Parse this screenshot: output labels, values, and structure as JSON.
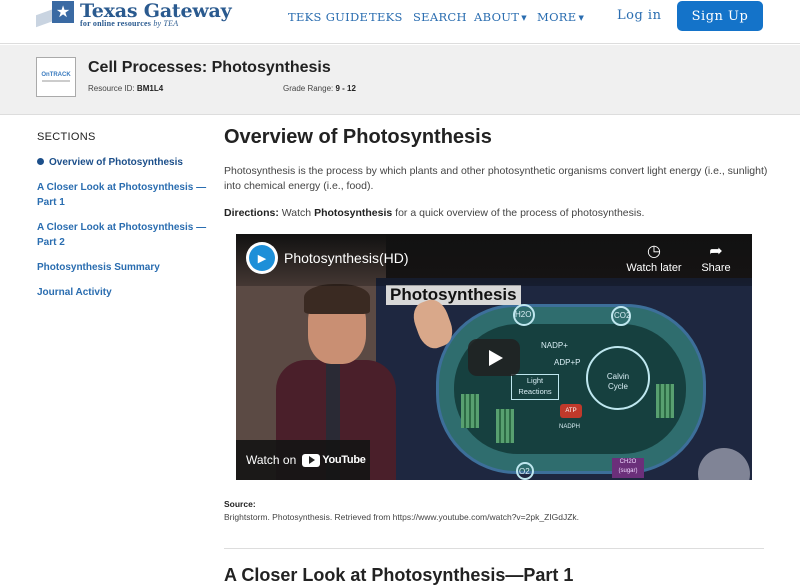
{
  "brand": {
    "title": "Texas Gateway",
    "subtitle_main": "for online resources",
    "subtitle_by": "by TEA"
  },
  "nav": {
    "items": [
      {
        "label": "TEKS GUIDE"
      },
      {
        "label": "TEKS"
      },
      {
        "label": "SEARCH"
      },
      {
        "label": "ABOUT"
      },
      {
        "label": "MORE"
      }
    ],
    "login_label": "Log in",
    "signup_label": "Sign Up"
  },
  "resource": {
    "badge_text_on": "On",
    "badge_text_track": "TRACK",
    "title": "Cell Processes: Photosynthesis",
    "id_label": "Resource ID:",
    "id_value": "BM1L4",
    "grade_label": "Grade Range:",
    "grade_value": "9 - 12"
  },
  "sidebar": {
    "heading": "SECTIONS",
    "items": [
      {
        "label": "Overview of Photosynthesis"
      },
      {
        "label": "A Closer Look at Photosynthesis —Part 1"
      },
      {
        "label": "A Closer Look at Photosynthesis —Part 2"
      },
      {
        "label": "Photosynthesis Summary"
      },
      {
        "label": "Journal Activity"
      }
    ]
  },
  "main": {
    "heading": "Overview of Photosynthesis",
    "intro": "Photosynthesis is the process by which plants and other photosynthetic organisms convert light energy (i.e., sunlight) into chemical energy (i.e., food).",
    "directions_label": "Directions:",
    "directions_pre": "Watch",
    "directions_bold": "Photosynthesis",
    "directions_post": "for a quick overview of the process of photosynthesis.",
    "source_label": "Source:",
    "source_text": "Brightstorm. Photosynthesis. Retrieved from https://www.youtube.com/watch?v=2pk_ZIGdJZk.",
    "next_heading": "A Closer Look at Photosynthesis—Part 1"
  },
  "video": {
    "title": "Photosynthesis(HD)",
    "watch_later": "Watch later",
    "share": "Share",
    "watch_on": "Watch on",
    "youtube": "YouTube",
    "board_title": "Photosynthesis",
    "board_labels": {
      "h2o": "H2O",
      "co2": "CO2",
      "nadp": "NADP+",
      "adp": "ADP+P",
      "light_reactions": "Light Reactions",
      "atp": "ATP",
      "nadph": "NADPH",
      "calvin_cycle": "Calvin Cycle",
      "o2": "O2",
      "ch2o": "CH2O",
      "sugar": "(sugar)"
    }
  },
  "colors": {
    "brand_blue": "#2a5a8f",
    "link_blue": "#2a6db0",
    "signup_bg": "#1473c9"
  }
}
